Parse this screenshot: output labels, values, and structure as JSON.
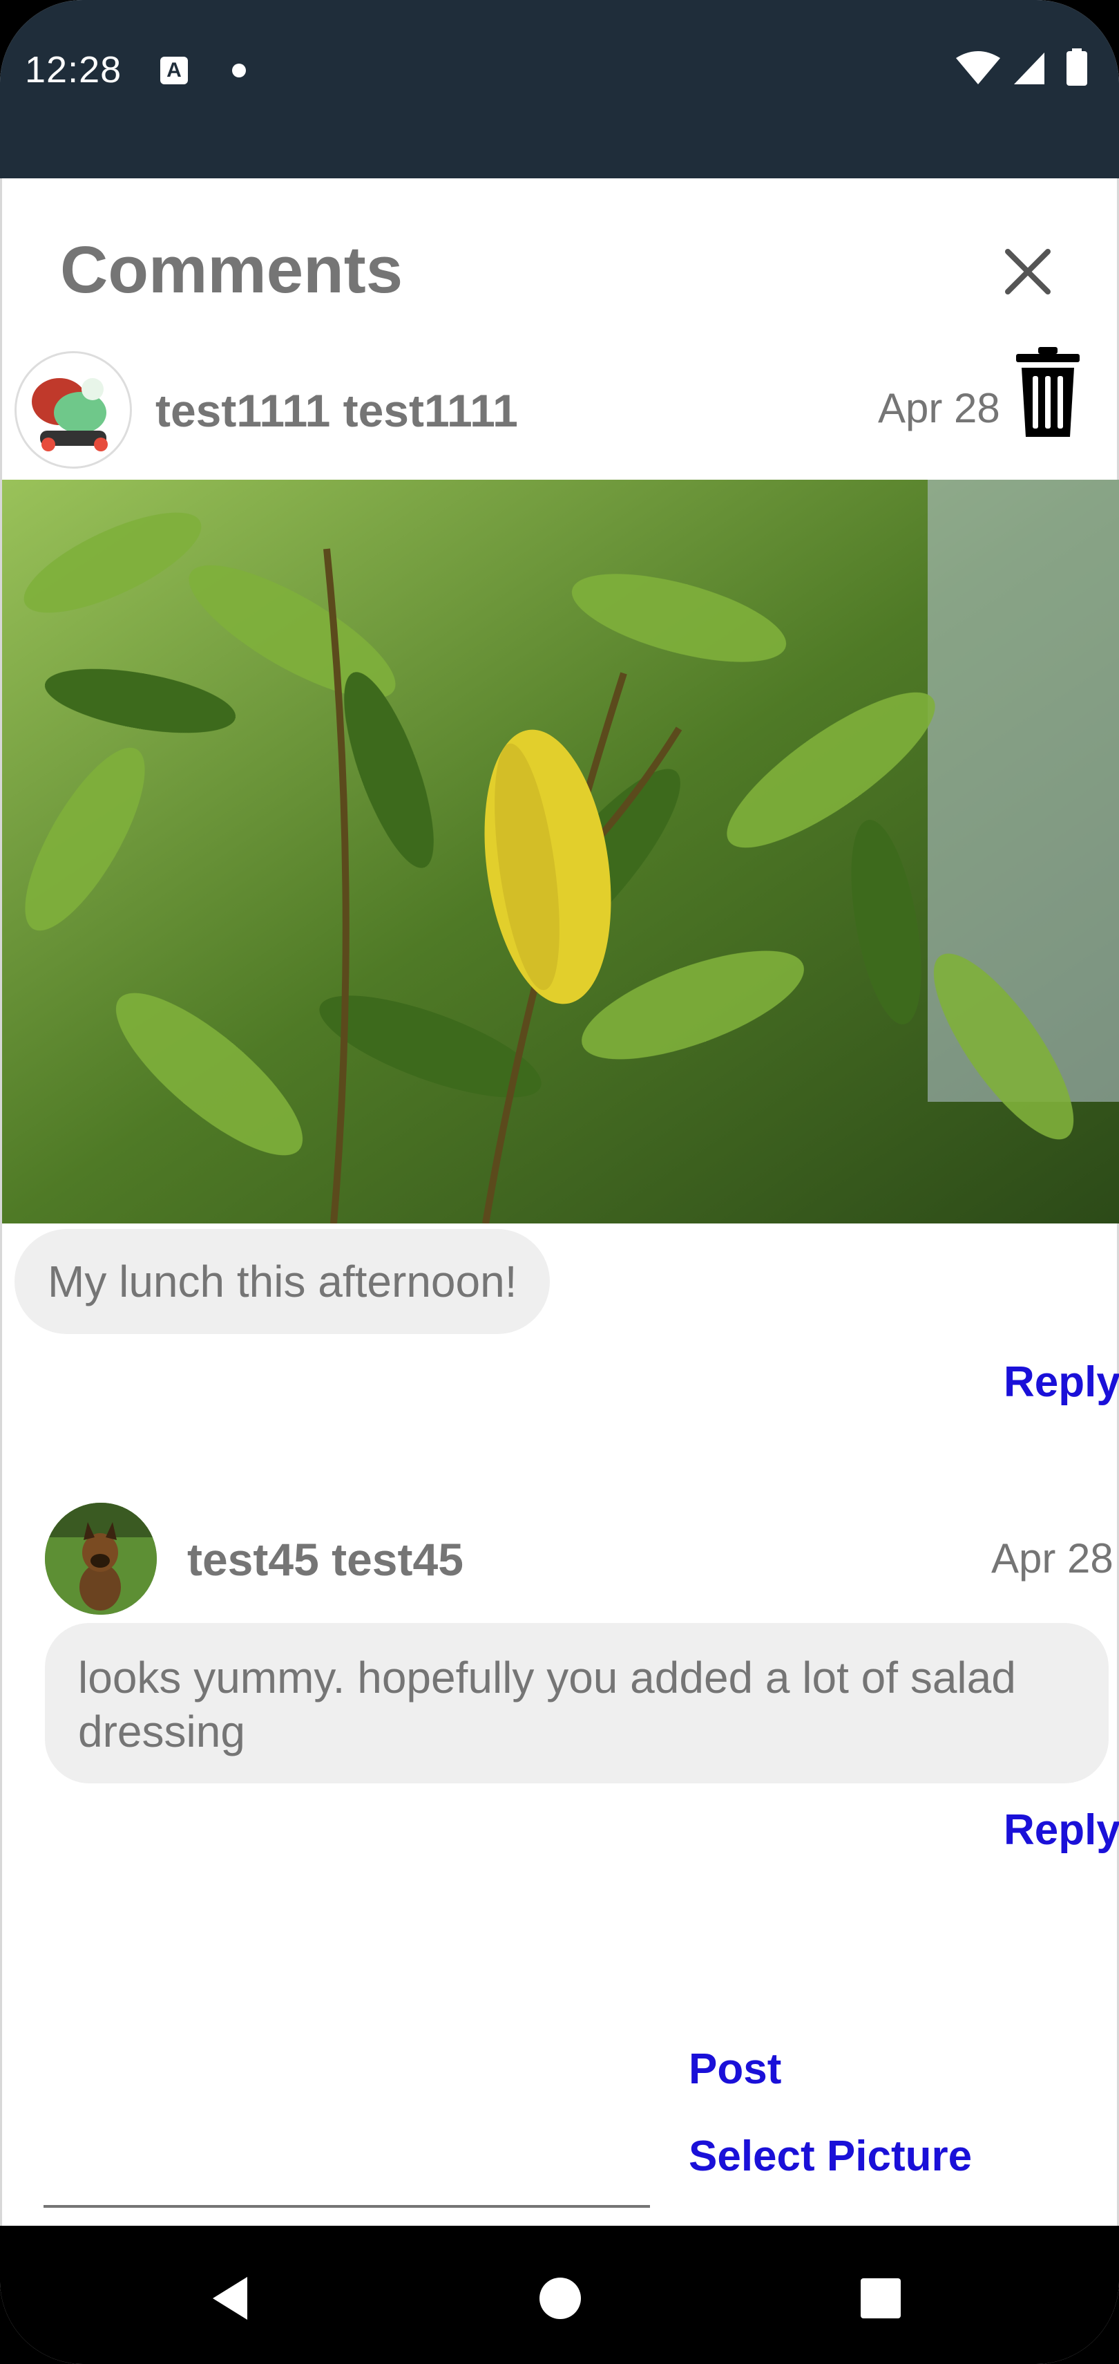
{
  "status_bar": {
    "time": "12:28",
    "notification_icon": "a-icon",
    "dot": "notification-dot"
  },
  "dialog": {
    "title": "Comments",
    "close_icon": "close-icon"
  },
  "post": {
    "author": "test1111 test1111",
    "date": "Apr 28",
    "delete_icon": "trash-icon",
    "image_alt": "photo of green leaves",
    "caption": "My lunch this afternoon!",
    "reply_label": "Reply"
  },
  "comments": [
    {
      "author": "test45 test45",
      "date": "Apr 28",
      "text": "looks yummy. hopefully you added a lot of salad dressing",
      "reply_label": "Reply"
    }
  ],
  "composer": {
    "input_value": "",
    "post_label": "Post",
    "select_picture_label": "Select Picture"
  },
  "nav_bar": {
    "back_icon": "back-icon",
    "home_icon": "home-icon",
    "recents_icon": "recents-icon"
  },
  "colors": {
    "status_bar": "#1f2d3a",
    "link": "#1a10d8",
    "text_gray": "#757575",
    "bubble": "#efefef"
  }
}
